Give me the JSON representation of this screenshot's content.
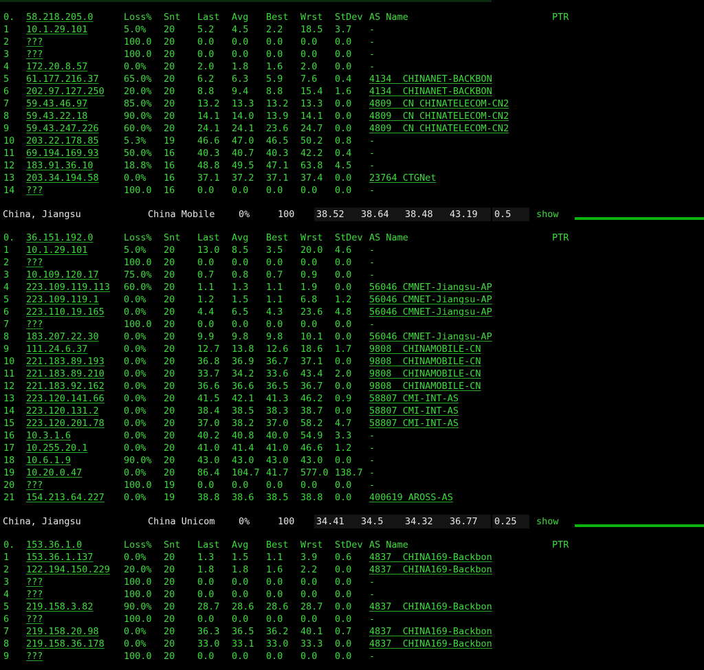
{
  "headers": {
    "idx": "0.",
    "loss": "Loss%",
    "snt": "Snt",
    "last": "Last",
    "avg": "Avg",
    "best": "Best",
    "wrst": "Wrst",
    "stdev": "StDev",
    "as": "AS Name",
    "ptr": "PTR"
  },
  "blocks": [
    {
      "origin": "58.218.205.0",
      "rows": [
        [
          "1",
          "10.1.29.101",
          "5.0%",
          "20",
          "5.2",
          "4.5",
          "2.2",
          "18.5",
          "3.7",
          "-"
        ],
        [
          "2",
          "???",
          "100.0",
          "20",
          "0.0",
          "0.0",
          "0.0",
          "0.0",
          "0.0",
          "-"
        ],
        [
          "3",
          "???",
          "100.0",
          "20",
          "0.0",
          "0.0",
          "0.0",
          "0.0",
          "0.0",
          "-"
        ],
        [
          "4",
          "172.20.8.57",
          "0.0%",
          "20",
          "2.0",
          "1.8",
          "1.6",
          "2.0",
          "0.0",
          "-"
        ],
        [
          "5",
          "61.177.216.37",
          "65.0%",
          "20",
          "6.2",
          "6.3",
          "5.9",
          "7.6",
          "0.4",
          "4134  CHINANET-BACKBON"
        ],
        [
          "6",
          "202.97.127.250",
          "20.0%",
          "20",
          "8.8",
          "9.4",
          "8.8",
          "15.4",
          "1.6",
          "4134  CHINANET-BACKBON"
        ],
        [
          "7",
          "59.43.46.97",
          "85.0%",
          "20",
          "13.2",
          "13.3",
          "13.2",
          "13.3",
          "0.0",
          "4809  CN CHINATELECOM-CN2"
        ],
        [
          "8",
          "59.43.22.18",
          "90.0%",
          "20",
          "14.1",
          "14.0",
          "13.9",
          "14.1",
          "0.0",
          "4809  CN CHINATELECOM-CN2"
        ],
        [
          "9",
          "59.43.247.226",
          "60.0%",
          "20",
          "24.1",
          "24.1",
          "23.6",
          "24.7",
          "0.0",
          "4809  CN CHINATELECOM-CN2"
        ],
        [
          "10",
          "203.22.178.85",
          "5.3%",
          "19",
          "46.6",
          "47.0",
          "46.5",
          "50.2",
          "0.8",
          "-"
        ],
        [
          "11",
          "69.194.169.93",
          "50.0%",
          "16",
          "40.3",
          "40.7",
          "40.3",
          "42.2",
          "0.4",
          "-"
        ],
        [
          "12",
          "183.91.36.10",
          "18.8%",
          "16",
          "48.8",
          "49.5",
          "47.1",
          "63.8",
          "4.5",
          "-"
        ],
        [
          "13",
          "203.34.194.58",
          "0.0%",
          "16",
          "37.1",
          "37.2",
          "37.1",
          "37.4",
          "0.0",
          "23764 CTGNet"
        ],
        [
          "14",
          "???",
          "100.0",
          "16",
          "0.0",
          "0.0",
          "0.0",
          "0.0",
          "0.0",
          "-"
        ]
      ]
    },
    {
      "origin": "36.151.192.0",
      "rows": [
        [
          "1",
          "10.1.29.101",
          "5.0%",
          "20",
          "13.0",
          "8.5",
          "3.5",
          "20.0",
          "4.6",
          "-"
        ],
        [
          "2",
          "???",
          "100.0",
          "20",
          "0.0",
          "0.0",
          "0.0",
          "0.0",
          "0.0",
          "-"
        ],
        [
          "3",
          "10.109.120.17",
          "75.0%",
          "20",
          "0.7",
          "0.8",
          "0.7",
          "0.9",
          "0.0",
          "-"
        ],
        [
          "4",
          "223.109.119.113",
          "60.0%",
          "20",
          "1.1",
          "1.3",
          "1.1",
          "1.9",
          "0.0",
          "56046 CMNET-Jiangsu-AP"
        ],
        [
          "5",
          "223.109.119.1",
          "0.0%",
          "20",
          "1.2",
          "1.5",
          "1.1",
          "6.8",
          "1.2",
          "56046 CMNET-Jiangsu-AP"
        ],
        [
          "6",
          "223.110.19.165",
          "0.0%",
          "20",
          "4.4",
          "6.5",
          "4.3",
          "23.6",
          "4.8",
          "56046 CMNET-Jiangsu-AP"
        ],
        [
          "7",
          "???",
          "100.0",
          "20",
          "0.0",
          "0.0",
          "0.0",
          "0.0",
          "0.0",
          "-"
        ],
        [
          "8",
          "183.207.22.30",
          "0.0%",
          "20",
          "9.9",
          "9.8",
          "9.8",
          "10.1",
          "0.0",
          "56046 CMNET-Jiangsu-AP"
        ],
        [
          "9",
          "111.24.6.37",
          "0.0%",
          "20",
          "12.7",
          "13.8",
          "12.6",
          "18.6",
          "1.7",
          "9808  CHINAMOBILE-CN"
        ],
        [
          "10",
          "221.183.89.193",
          "0.0%",
          "20",
          "36.8",
          "36.9",
          "36.7",
          "37.1",
          "0.0",
          "9808  CHINAMOBILE-CN"
        ],
        [
          "11",
          "221.183.89.210",
          "0.0%",
          "20",
          "33.7",
          "34.2",
          "33.6",
          "43.4",
          "2.0",
          "9808  CHINAMOBILE-CN"
        ],
        [
          "12",
          "221.183.92.162",
          "0.0%",
          "20",
          "36.6",
          "36.6",
          "36.5",
          "36.7",
          "0.0",
          "9808  CHINAMOBILE-CN"
        ],
        [
          "13",
          "223.120.141.66",
          "0.0%",
          "20",
          "41.5",
          "42.1",
          "41.3",
          "46.2",
          "0.9",
          "58807 CMI-INT-AS"
        ],
        [
          "14",
          "223.120.131.2",
          "0.0%",
          "20",
          "38.4",
          "38.5",
          "38.3",
          "38.7",
          "0.0",
          "58807 CMI-INT-AS"
        ],
        [
          "15",
          "223.120.201.78",
          "0.0%",
          "20",
          "37.0",
          "38.2",
          "37.0",
          "58.2",
          "4.7",
          "58807 CMI-INT-AS"
        ],
        [
          "16",
          "10.3.1.6",
          "0.0%",
          "20",
          "40.2",
          "40.8",
          "40.0",
          "54.9",
          "3.3",
          "-"
        ],
        [
          "17",
          "10.255.20.1",
          "0.0%",
          "20",
          "41.0",
          "41.4",
          "41.0",
          "46.6",
          "1.2",
          "-"
        ],
        [
          "18",
          "10.6.1.9",
          "90.0%",
          "20",
          "43.0",
          "43.0",
          "43.0",
          "43.0",
          "0.0",
          "-"
        ],
        [
          "19",
          "10.20.0.47",
          "0.0%",
          "20",
          "86.4",
          "104.7",
          "41.7",
          "577.0",
          "138.7",
          "-"
        ],
        [
          "20",
          "???",
          "100.0",
          "19",
          "0.0",
          "0.0",
          "0.0",
          "0.0",
          "0.0",
          "-"
        ],
        [
          "21",
          "154.213.64.227",
          "0.0%",
          "19",
          "38.8",
          "38.6",
          "38.5",
          "38.8",
          "0.0",
          "400619 AROSS-AS"
        ]
      ]
    },
    {
      "origin": "153.36.1.0",
      "rows": [
        [
          "1",
          "153.36.1.137",
          "0.0%",
          "20",
          "1.3",
          "1.5",
          "1.1",
          "3.9",
          "0.6",
          "4837  CHINA169-Backbon"
        ],
        [
          "2",
          "122.194.150.229",
          "20.0%",
          "20",
          "1.8",
          "1.8",
          "1.6",
          "2.2",
          "0.0",
          "4837  CHINA169-Backbon"
        ],
        [
          "3",
          "???",
          "100.0",
          "20",
          "0.0",
          "0.0",
          "0.0",
          "0.0",
          "0.0",
          "-"
        ],
        [
          "4",
          "???",
          "100.0",
          "20",
          "0.0",
          "0.0",
          "0.0",
          "0.0",
          "0.0",
          "-"
        ],
        [
          "5",
          "219.158.3.82",
          "90.0%",
          "20",
          "28.7",
          "28.6",
          "28.6",
          "28.7",
          "0.0",
          "4837  CHINA169-Backbon"
        ],
        [
          "6",
          "???",
          "100.0",
          "20",
          "0.0",
          "0.0",
          "0.0",
          "0.0",
          "0.0",
          "-"
        ],
        [
          "7",
          "219.158.20.98",
          "0.0%",
          "20",
          "36.3",
          "36.5",
          "36.2",
          "40.1",
          "0.7",
          "4837  CHINA169-Backbon"
        ],
        [
          "8",
          "219.158.36.178",
          "0.0%",
          "20",
          "33.0",
          "33.1",
          "33.0",
          "33.3",
          "0.0",
          "4837  CHINA169-Backbon"
        ],
        [
          "9",
          "???",
          "100.0",
          "20",
          "0.0",
          "0.0",
          "0.0",
          "0.0",
          "0.0",
          "-"
        ]
      ]
    }
  ],
  "summaries": [
    {
      "region": "China, Jiangsu",
      "isp": "China Mobile",
      "loss": "0%",
      "snt": "100",
      "last": "38.52",
      "avg": "38.64",
      "best": "38.48",
      "wrst": "43.19",
      "stdev": "0.5",
      "action": "show"
    },
    {
      "region": "China, Jiangsu",
      "isp": "China Unicom",
      "loss": "0%",
      "snt": "100",
      "last": "34.41",
      "avg": "34.5",
      "best": "34.32",
      "wrst": "36.77",
      "stdev": "0.25",
      "action": "show"
    }
  ]
}
